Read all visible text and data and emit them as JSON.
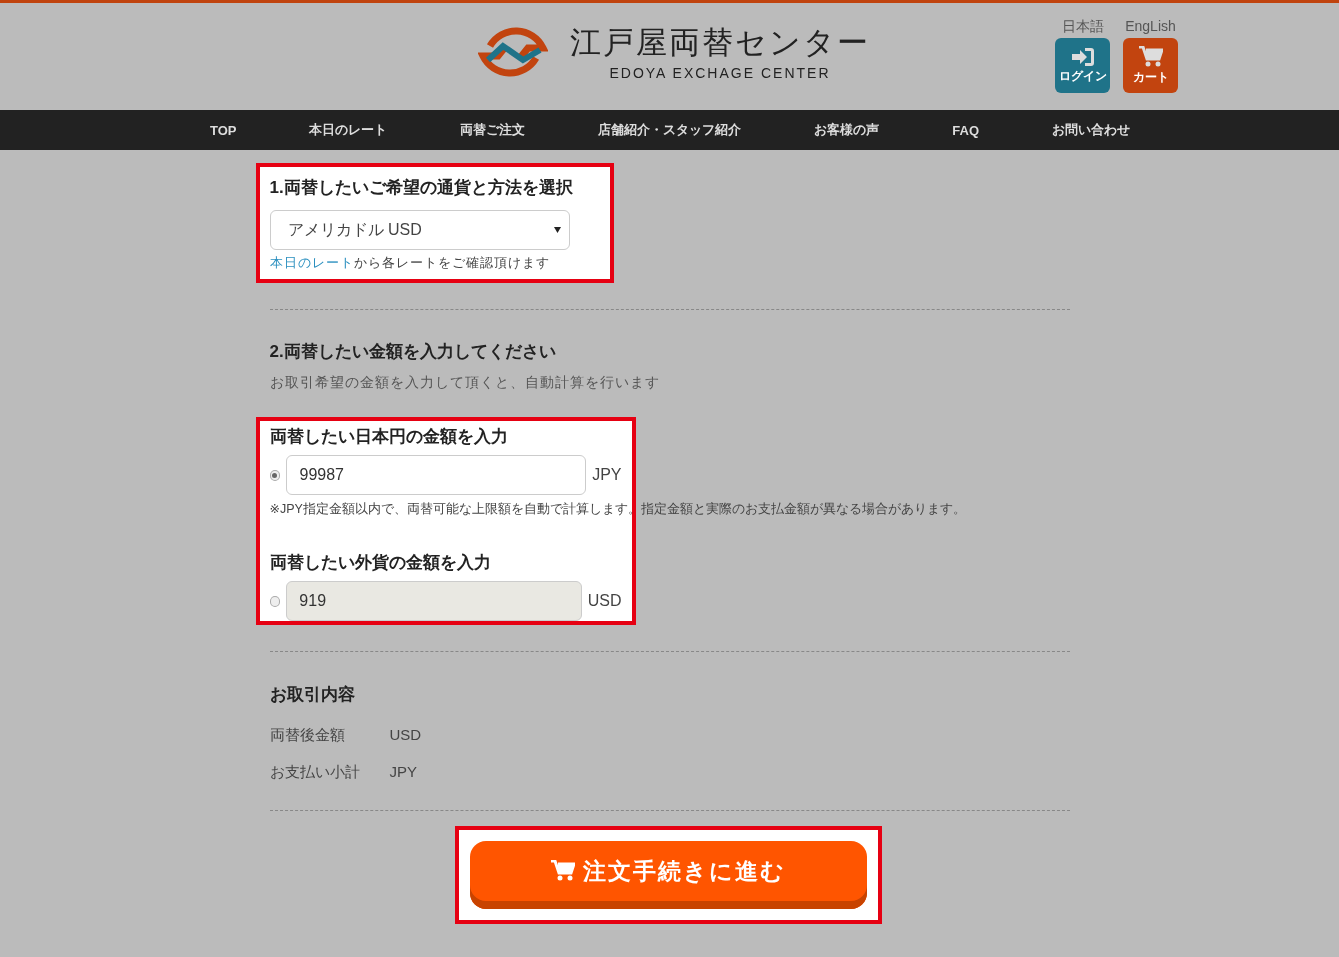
{
  "header": {
    "logo_title": "江戸屋両替センター",
    "logo_subtitle": "EDOYA EXCHAGE CENTER",
    "languages": [
      "日本語",
      "EngLish"
    ],
    "buttons": [
      {
        "kind": "login",
        "label": "ログイン"
      },
      {
        "kind": "cart",
        "label": "カート"
      }
    ]
  },
  "nav": [
    "TOP",
    "本日のレート",
    "両替ご注文",
    "店舗紹介・スタッフ紹介",
    "お客様の声",
    "FAQ",
    "お問い合わせ"
  ],
  "step1": {
    "title": "1.両替したいご希望の通貨と方法を選択",
    "currency": "アメリカドル USD",
    "note_link": "本日のレート",
    "note": "から各レートをご確認頂けます"
  },
  "step2": {
    "title": "2.両替したい金額を入力してください",
    "description": "お取引希望の金額を入力して頂くと、自動計算を行います",
    "inputs": [
      {
        "label": "両替したい日本円の金額を入力",
        "selected": true,
        "value": "99987",
        "unit": "JPY",
        "disabled": false,
        "note": "※JPY指定金額以内で、両替可能な上限額を自動で計算します。指定金額と実際のお支払金額が異なる場合があります。"
      },
      {
        "label": "両替したい外貨の金額を入力",
        "selected": false,
        "value": "919",
        "unit": "USD",
        "disabled": true
      }
    ]
  },
  "summary": {
    "title": "お取引内容",
    "rows": [
      {
        "label": "両替後金額",
        "value": "USD"
      },
      {
        "label": "お支払い小計",
        "value": "JPY"
      }
    ]
  },
  "submit": "注文手続きに進む"
}
